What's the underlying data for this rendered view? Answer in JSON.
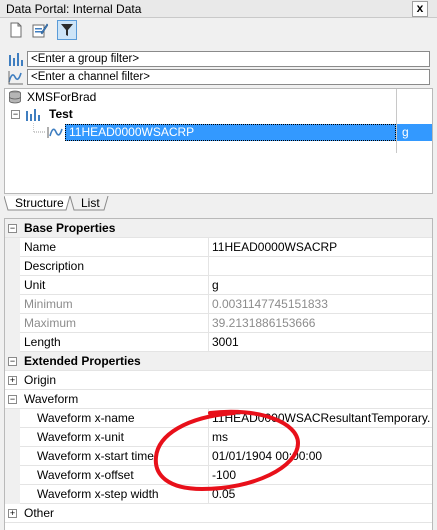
{
  "window": {
    "title": "Data Portal: Internal Data",
    "close_label": "x"
  },
  "toolbar": {
    "buttons": [
      "new-icon",
      "edit-icon",
      "filter-icon"
    ]
  },
  "filters": {
    "group_placeholder": "<Enter a group filter>",
    "channel_placeholder": "<Enter a channel filter>"
  },
  "tree": {
    "root": "XMSForBrad",
    "group": "Test",
    "channel": "11HEAD0000WSACRP",
    "channel_unit": "g"
  },
  "tabs": {
    "structure": "Structure",
    "list": "List"
  },
  "properties": {
    "base_category": "Base Properties",
    "base": [
      {
        "name": "Name",
        "value": "11HEAD0000WSACRP"
      },
      {
        "name": "Description",
        "value": ""
      },
      {
        "name": "Unit",
        "value": "g"
      },
      {
        "name": "Minimum",
        "value": "0.0031147745151833"
      },
      {
        "name": "Maximum",
        "value": "39.2131886153666"
      },
      {
        "name": "Length",
        "value": "3001"
      }
    ],
    "extended_category": "Extended Properties",
    "origin": "Origin",
    "waveform": "Waveform",
    "waveform_props": [
      {
        "name": "Waveform x-name",
        "value": "11HEAD0000WSACResultantTemporary..."
      },
      {
        "name": "Waveform x-unit",
        "value": "ms"
      },
      {
        "name": "Waveform x-start time",
        "value": "01/01/1904 00:00:00"
      },
      {
        "name": "Waveform x-offset",
        "value": "-100"
      },
      {
        "name": "Waveform x-step width",
        "value": "0.05"
      }
    ],
    "other": "Other"
  },
  "annotation_color": "#e8101a"
}
